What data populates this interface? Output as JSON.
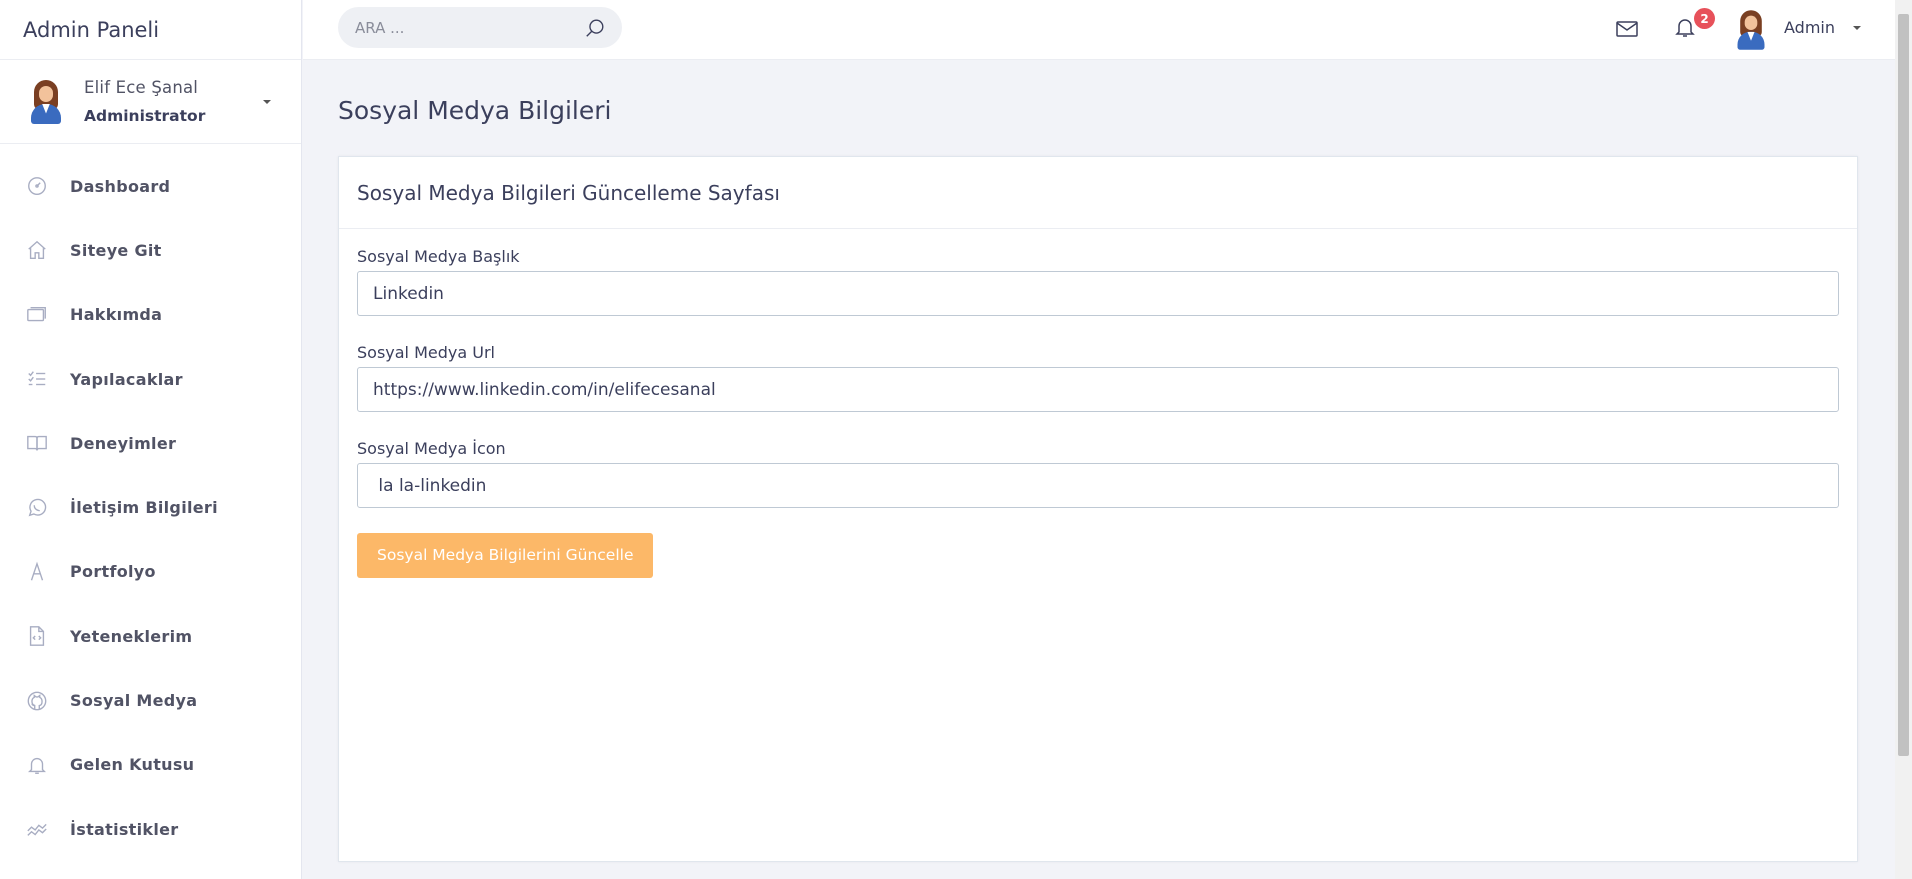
{
  "sidebar": {
    "brand": "Admin Paneli",
    "profile": {
      "name": "Elif Ece Şanal",
      "role": "Administrator"
    },
    "items": [
      {
        "label": "Dashboard",
        "icon": "speedometer-icon"
      },
      {
        "label": "Siteye Git",
        "icon": "home-icon"
      },
      {
        "label": "Hakkımda",
        "icon": "cards-icon"
      },
      {
        "label": "Yapılacaklar",
        "icon": "list-icon"
      },
      {
        "label": "Deneyimler",
        "icon": "book-icon"
      },
      {
        "label": "İletişim Bilgileri",
        "icon": "whatsapp-icon"
      },
      {
        "label": "Portfolyo",
        "icon": "letter-a-icon"
      },
      {
        "label": "Yeteneklerim",
        "icon": "code-file-icon"
      },
      {
        "label": "Sosyal Medya",
        "icon": "github-icon"
      },
      {
        "label": "Gelen Kutusu",
        "icon": "bell-icon"
      },
      {
        "label": "İstatistikler",
        "icon": "chart-line-icon"
      }
    ]
  },
  "topbar": {
    "search_placeholder": "ARA ...",
    "notification_count": "2",
    "user_label": "Admin"
  },
  "main": {
    "page_title": "Sosyal Medya Bilgileri",
    "card_title": "Sosyal Medya Bilgileri Güncelleme Sayfası",
    "fields": [
      {
        "label": "Sosyal Medya Başlık",
        "value": "Linkedin"
      },
      {
        "label": "Sosyal Medya Url",
        "value": "https://www.linkedin.com/in/elifecesanal"
      },
      {
        "label": "Sosyal Medya İcon",
        "value": " la la-linkedin"
      }
    ],
    "submit_label": "Sosyal Medya Bilgilerini Güncelle"
  },
  "colors": {
    "accent_button": "#fcb868",
    "badge": "#e7515a",
    "background": "#f2f3f8"
  }
}
